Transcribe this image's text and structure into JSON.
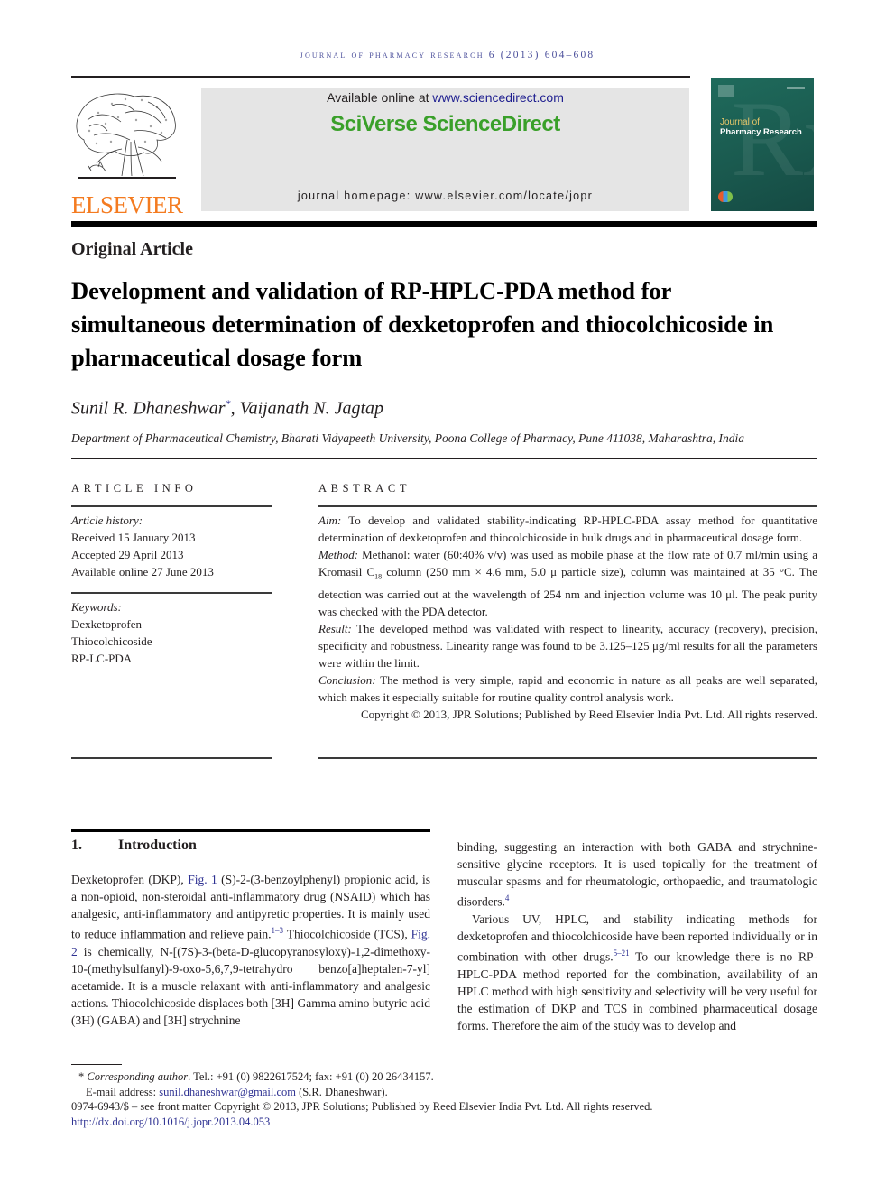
{
  "running_head": "journal of pharmacy research 6 (2013) 604–608",
  "header": {
    "publisher_logo_icon": "elsevier-tree-icon",
    "publisher_wordmark": "ELSEVIER",
    "available_online_prefix": "Available online at ",
    "available_online_link": "www.sciencedirect.com",
    "platform_brand": "SciVerse ScienceDirect",
    "journal_homepage_prefix": "journal homepage: ",
    "journal_homepage_url": "www.elsevier.com/locate/jopr",
    "cover": {
      "title_line1": "Journal of",
      "title_line2": "Pharmacy Research",
      "background_color": "#1a5a4f",
      "watermark": "Rx"
    }
  },
  "article": {
    "type": "Original Article",
    "title": "Development and validation of RP-HPLC-PDA method for simultaneous determination of dexketoprofen and thiocolchicoside in pharmaceutical dosage form",
    "authors": [
      {
        "name": "Sunil R. Dhaneshwar",
        "mark": "*"
      },
      {
        "name": "Vaijanath N. Jagtap",
        "mark": ""
      }
    ],
    "author_separator": ", ",
    "affiliation": "Department of Pharmaceutical Chemistry, Bharati Vidyapeeth University, Poona College of Pharmacy, Pune 411038, Maharashtra, India"
  },
  "article_info": {
    "heading": "ARTICLE INFO",
    "history_label": "Article history:",
    "history": [
      "Received 15 January 2013",
      "Accepted 29 April 2013",
      "Available online 27 June 2013"
    ],
    "keywords_label": "Keywords:",
    "keywords": [
      "Dexketoprofen",
      "Thiocolchicoside",
      "RP-LC-PDA"
    ]
  },
  "abstract": {
    "heading": "ABSTRACT",
    "sections": [
      {
        "label": "Aim:",
        "text": " To develop and validated stability-indicating RP-HPLC-PDA assay method for quantitative determination of dexketoprofen and thiocolchicoside in bulk drugs and in pharmaceutical dosage form."
      },
      {
        "label": "Method:",
        "text_before": " Methanol: water (60:40% v/v) was used as mobile phase at the flow rate of 0.7 ml/min using a Kromasil C",
        "subscript": "18",
        "text_after": " column (250 mm × 4.6 mm, 5.0 μ particle size), column was maintained at 35 °C. The detection was carried out at the wavelength of 254 nm and injection volume was 10 μl. The peak purity was checked with the PDA detector."
      },
      {
        "label": "Result:",
        "text": " The developed method was validated with respect to linearity, accuracy (recovery), precision, specificity and robustness. Linearity range was found to be 3.125–125 μg/ml results for all the parameters were within the limit."
      },
      {
        "label": "Conclusion:",
        "text": " The method is very simple, rapid and economic in nature as all peaks are well separated, which makes it especially suitable for routine quality control analysis work."
      }
    ],
    "copyright": "Copyright © 2013, JPR Solutions; Published by Reed Elsevier India Pvt. Ltd. All rights reserved."
  },
  "introduction": {
    "number": "1.",
    "heading": "Introduction",
    "left": {
      "p1_a": "Dexketoprofen (DKP), ",
      "p1_link1": "Fig. 1",
      "p1_b": " (S)-2-(3-benzoylphenyl) propionic acid, is a non-opioid, non-steroidal anti-inflammatory drug (NSAID) which has analgesic, anti-inflammatory and antipyretic properties. It is mainly used to reduce inflammation and relieve pain.",
      "p1_ref1": "1–3",
      "p1_c": " Thiocolchicoside (TCS), ",
      "p1_link2": "Fig. 2",
      "p1_d": " is chemically, N-[(7S)-3-(beta-D-glucopyranosyloxy)-1,2-dimethoxy-10-(methylsulfanyl)-9-oxo-5,6,7,9-tetrahydro benzo[a]heptalen-7-yl] acetamide. It is a muscle relaxant with anti-inflammatory and analgesic actions. Thiocolchicoside displaces both [3H] Gamma amino butyric acid (3H) (GABA) and [3H] strychnine"
    },
    "right": {
      "p1_a": "binding, suggesting an interaction with both GABA and strychnine-sensitive glycine receptors. It is used topically for the treatment of muscular spasms and for rheumatologic, orthopaedic, and traumatologic disorders.",
      "p1_ref": "4",
      "p2_a": "Various UV, HPLC, and stability indicating methods for dexketoprofen and thiocolchicoside have been reported individually or in combination with other drugs.",
      "p2_ref": "5–21",
      "p2_b": " To our knowledge there is no RP-HPLC-PDA method reported for the combination, availability of an HPLC method with high sensitivity and selectivity will be very useful for the estimation of DKP and TCS in combined pharmaceutical dosage forms. Therefore the aim of the study was to develop and"
    }
  },
  "footnotes": {
    "corresponding_mark": "*",
    "corresponding_label": "Corresponding author",
    "corresponding_contact": ". Tel.: +91 (0) 9822617524; fax: +91 (0) 20 26434157.",
    "email_label": "E-mail address: ",
    "email": "sunil.dhaneshwar@gmail.com",
    "email_owner": " (S.R. Dhaneshwar).",
    "issn_line": "0974-6943/$ – see front matter Copyright © 2013, JPR Solutions; Published by Reed Elsevier India Pvt. Ltd. All rights reserved.",
    "doi": "http://dx.doi.org/10.1016/j.jopr.2013.04.053"
  }
}
